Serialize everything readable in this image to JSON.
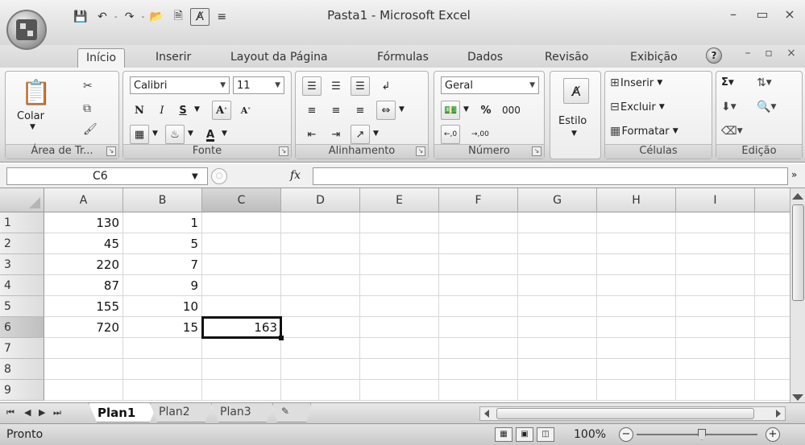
{
  "window": {
    "title": "Pasta1 - Microsoft Excel",
    "qat_undo_sep": "-",
    "qat_redo_sep": "-"
  },
  "tabs": [
    "Início",
    "Inserir",
    "Layout da Página",
    "Fórmulas",
    "Dados",
    "Revisão",
    "Exibição"
  ],
  "ribbon": {
    "clipboard": {
      "paste_label": "Colar",
      "group_label": "Área de Tr..."
    },
    "font": {
      "font_name": "Calibri",
      "font_size": "11",
      "bold": "N",
      "italic": "I",
      "underline": "S",
      "grow": "A",
      "shrink": "A",
      "font_color": "A",
      "group_label": "Fonte"
    },
    "alignment": {
      "group_label": "Alinhamento"
    },
    "number": {
      "format": "Geral",
      "percent": "%",
      "thousands": "000",
      "inc_decimal": ",0",
      "dec_decimal": ",00",
      "group_label": "Número"
    },
    "styles": {
      "label": "Estilo"
    },
    "cells": {
      "insert": "Inserir",
      "delete": "Excluir",
      "format": "Formatar",
      "group_label": "Células"
    },
    "editing": {
      "group_label": "Edição"
    }
  },
  "formula_bar": {
    "name_box": "C6",
    "fx": "fx",
    "formula": ""
  },
  "grid": {
    "columns": [
      "A",
      "B",
      "C",
      "D",
      "E",
      "F",
      "G",
      "H",
      "I"
    ],
    "rows": [
      "1",
      "2",
      "3",
      "4",
      "5",
      "6",
      "7",
      "8",
      "9"
    ],
    "cells": [
      [
        "130",
        "1",
        ""
      ],
      [
        "45",
        "5",
        ""
      ],
      [
        "220",
        "7",
        ""
      ],
      [
        "87",
        "9",
        ""
      ],
      [
        "155",
        "10",
        ""
      ],
      [
        "720",
        "15",
        "163"
      ],
      [
        "",
        "",
        ""
      ],
      [
        "",
        "",
        ""
      ],
      [
        "",
        "",
        ""
      ]
    ],
    "active_cell": "C6"
  },
  "sheets": [
    "Plan1",
    "Plan2",
    "Plan3"
  ],
  "status": {
    "text": "Pronto",
    "zoom": "100%",
    "minus": "−",
    "plus": "+"
  },
  "icons": {
    "save": "save-icon",
    "undo": "undo-icon",
    "redo": "redo-icon",
    "open": "open-icon",
    "print-preview": "print-preview-icon",
    "spelling": "spelling-icon",
    "customize": "customize-qat-icon"
  }
}
